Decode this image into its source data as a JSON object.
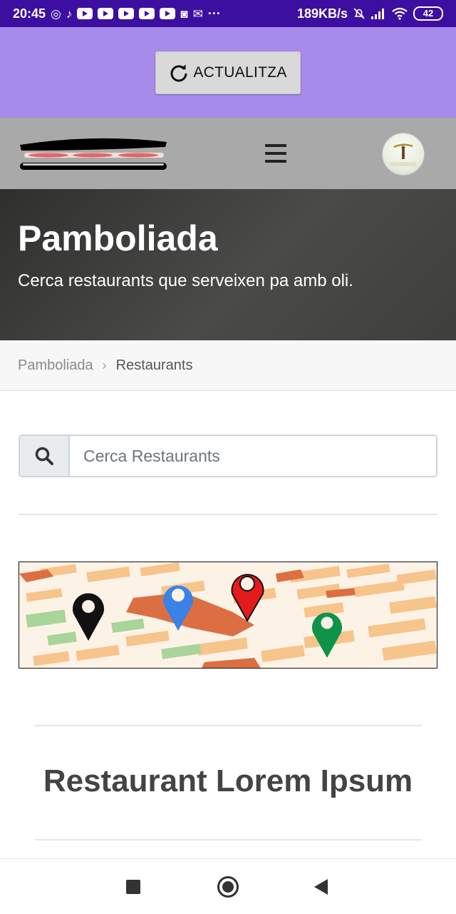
{
  "status_bar": {
    "time": "20:45",
    "network_speed": "189KB/s",
    "battery": "42",
    "more": "···",
    "apps": [
      "whatsapp-icon",
      "tiktok-icon",
      "youtube-icon",
      "youtube-icon",
      "youtube-icon",
      "youtube-icon",
      "youtube-icon",
      "instagram-icon",
      "gmail-icon"
    ]
  },
  "refresh": {
    "label": "ACTUALITZA",
    "icon": "refresh-icon"
  },
  "header": {
    "menu_icon": "hamburger-menu-icon",
    "avatar": "user-avatar"
  },
  "hero": {
    "title": "Pamboliada",
    "subtitle": "Cerca restaurants que serveixen pa amb oli."
  },
  "breadcrumb": {
    "home": "Pamboliada",
    "separator": "›",
    "current": "Restaurants"
  },
  "search": {
    "placeholder": "Cerca Restaurants",
    "value": ""
  },
  "map_banner": {
    "pins": [
      "black",
      "blue",
      "red",
      "green"
    ],
    "colors": {
      "pin_black": "#111111",
      "pin_blue": "#3b82e6",
      "pin_red": "#e31b1b",
      "pin_green": "#0d9448"
    }
  },
  "restaurant": {
    "name": "Restaurant Lorem Ipsum"
  },
  "colors": {
    "status_bar": "#3d0fa0",
    "refresh_band": "#a68beb",
    "header": "#a9a9a9",
    "hero": "#3f403d"
  }
}
